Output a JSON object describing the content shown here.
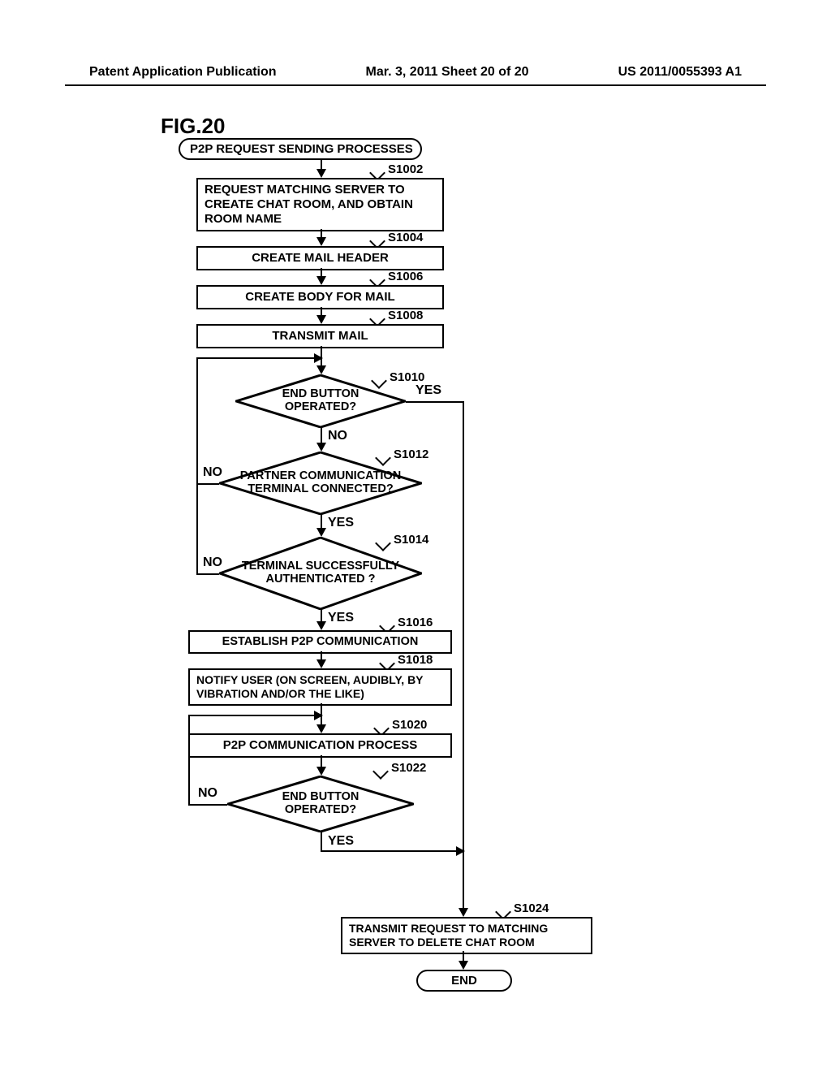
{
  "header": {
    "left": "Patent Application Publication",
    "center": "Mar. 3, 2011  Sheet 20 of 20",
    "right": "US 2011/0055393 A1"
  },
  "figure_label": "FIG.20",
  "terminators": {
    "start": "P2P REQUEST SENDING PROCESSES",
    "end": "END"
  },
  "steps": {
    "s1002": {
      "tag": "S1002",
      "text": "REQUEST MATCHING SERVER TO CREATE CHAT ROOM, AND OBTAIN ROOM NAME"
    },
    "s1004": {
      "tag": "S1004",
      "text": "CREATE MAIL HEADER"
    },
    "s1006": {
      "tag": "S1006",
      "text": "CREATE BODY FOR MAIL"
    },
    "s1008": {
      "tag": "S1008",
      "text": "TRANSMIT MAIL"
    },
    "s1010": {
      "tag": "S1010",
      "text": "END BUTTON OPERATED?"
    },
    "s1012": {
      "tag": "S1012",
      "text": "PARTNER COMMUNICATION TERMINAL CONNECTED?"
    },
    "s1014": {
      "tag": "S1014",
      "text": "TERMINAL SUCCESSFULLY AUTHENTICATED ?"
    },
    "s1016": {
      "tag": "S1016",
      "text": "ESTABLISH P2P COMMUNICATION"
    },
    "s1018": {
      "tag": "S1018",
      "text": "NOTIFY USER (ON SCREEN, AUDIBLY, BY VIBRATION AND/OR THE LIKE)"
    },
    "s1020": {
      "tag": "S1020",
      "text": "P2P COMMUNICATION PROCESS"
    },
    "s1022": {
      "tag": "S1022",
      "text": "END BUTTON OPERATED?"
    },
    "s1024": {
      "tag": "S1024",
      "text": "TRANSMIT REQUEST TO MATCHING SERVER TO DELETE CHAT ROOM"
    }
  },
  "branch": {
    "yes": "YES",
    "no": "NO"
  }
}
